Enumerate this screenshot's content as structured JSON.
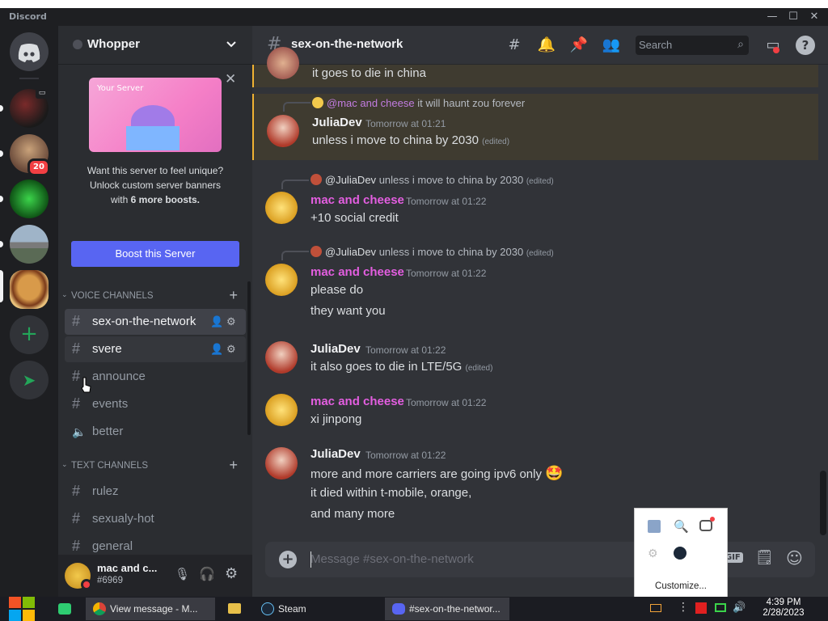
{
  "app": {
    "brand": "Discord"
  },
  "window_controls": {
    "minimize": "—",
    "maximize": "☐",
    "close": "✕"
  },
  "rail": {
    "servers": [
      {
        "name": "home"
      },
      {
        "name": "server-1"
      },
      {
        "name": "server-2",
        "badge": "20"
      },
      {
        "name": "server-3"
      },
      {
        "name": "server-4"
      },
      {
        "name": "whopper"
      }
    ],
    "add_label": "+",
    "explore_label": "➤"
  },
  "server": {
    "name": "Whopper",
    "boost": {
      "banner_label": "Your Server",
      "line1": "Want this server to feel unique?",
      "line2": "Unlock custom server banners",
      "line3_prefix": "with ",
      "line3_bold": "6 more boosts.",
      "button": "Boost this Server"
    },
    "voice_category": "VOICE CHANNELS",
    "voice_channels": [
      {
        "name": "sex-on-the-network",
        "icon": "#"
      },
      {
        "name": "svere",
        "icon": "#"
      },
      {
        "name": "announce",
        "icon": "#"
      },
      {
        "name": "events",
        "icon": "#"
      },
      {
        "name": "better",
        "icon": "🔈"
      }
    ],
    "text_category": "TEXT CHANNELS",
    "text_channels": [
      {
        "name": "rulez",
        "icon": "#"
      },
      {
        "name": "sexualy-hot",
        "icon": "#"
      },
      {
        "name": "general",
        "icon": "#"
      }
    ]
  },
  "user": {
    "name": "mac and c...",
    "tag": "#6969"
  },
  "channel": {
    "hash": "#",
    "name": "sex-on-the-network",
    "search_placeholder": "Search",
    "composer_placeholder": "Message #sex-on-the-network",
    "gif_label": "GIF"
  },
  "messages": [
    {
      "body": "it goes to die in china"
    },
    {
      "reply_to": "@mac and cheese",
      "reply_text": "it will haunt zou forever",
      "author": "JuliaDev",
      "author_color": "#f2f3f5",
      "time": "Tomorrow at 01:21",
      "lines": [
        "unless i move to china by 2030"
      ],
      "edited": "(edited)"
    },
    {
      "reply_to": "@JuliaDev",
      "reply_text": "unless i move to china by 2030",
      "reply_edited": "(edited)",
      "author": "mac and cheese",
      "author_color": "#e35ee0",
      "time": "Tomorrow at 01:22",
      "lines": [
        "+10 social credit"
      ]
    },
    {
      "reply_to": "@JuliaDev",
      "reply_text": "unless i move to china by 2030",
      "reply_edited": "(edited)",
      "author": "mac and cheese",
      "author_color": "#e35ee0",
      "time": "Tomorrow at 01:22",
      "lines": [
        "please do",
        "they want you"
      ]
    },
    {
      "author": "JuliaDev",
      "author_color": "#f2f3f5",
      "time": "Tomorrow at 01:22",
      "lines": [
        "it also goes to die in LTE/5G"
      ],
      "edited": "(edited)"
    },
    {
      "author": "mac and cheese",
      "author_color": "#e35ee0",
      "time": "Tomorrow at 01:22",
      "lines": [
        "xi jinpong"
      ]
    },
    {
      "author": "JuliaDev",
      "author_color": "#f2f3f5",
      "time": "Tomorrow at 01:22",
      "lines": [
        "more and more carriers are going ipv6 only",
        "it died within t-mobile, orange,",
        "and many more"
      ],
      "emoji": "🤩"
    }
  ],
  "tray_popup": {
    "customize": "Customize..."
  },
  "taskbar": {
    "tasks": [
      {
        "label": "View message - M...",
        "icon": "chrome-icon"
      },
      {
        "label": "Steam",
        "icon": "steam-icon"
      },
      {
        "label": "#sex-on-the-networ...",
        "icon": "discord-icon"
      }
    ],
    "clock_time": "4:39 PM",
    "clock_date": "2/28/2023"
  },
  "colors": {
    "accent": "#5865f2",
    "mention_highlight": "#f0b232",
    "mac_name": "#e35ee0"
  }
}
